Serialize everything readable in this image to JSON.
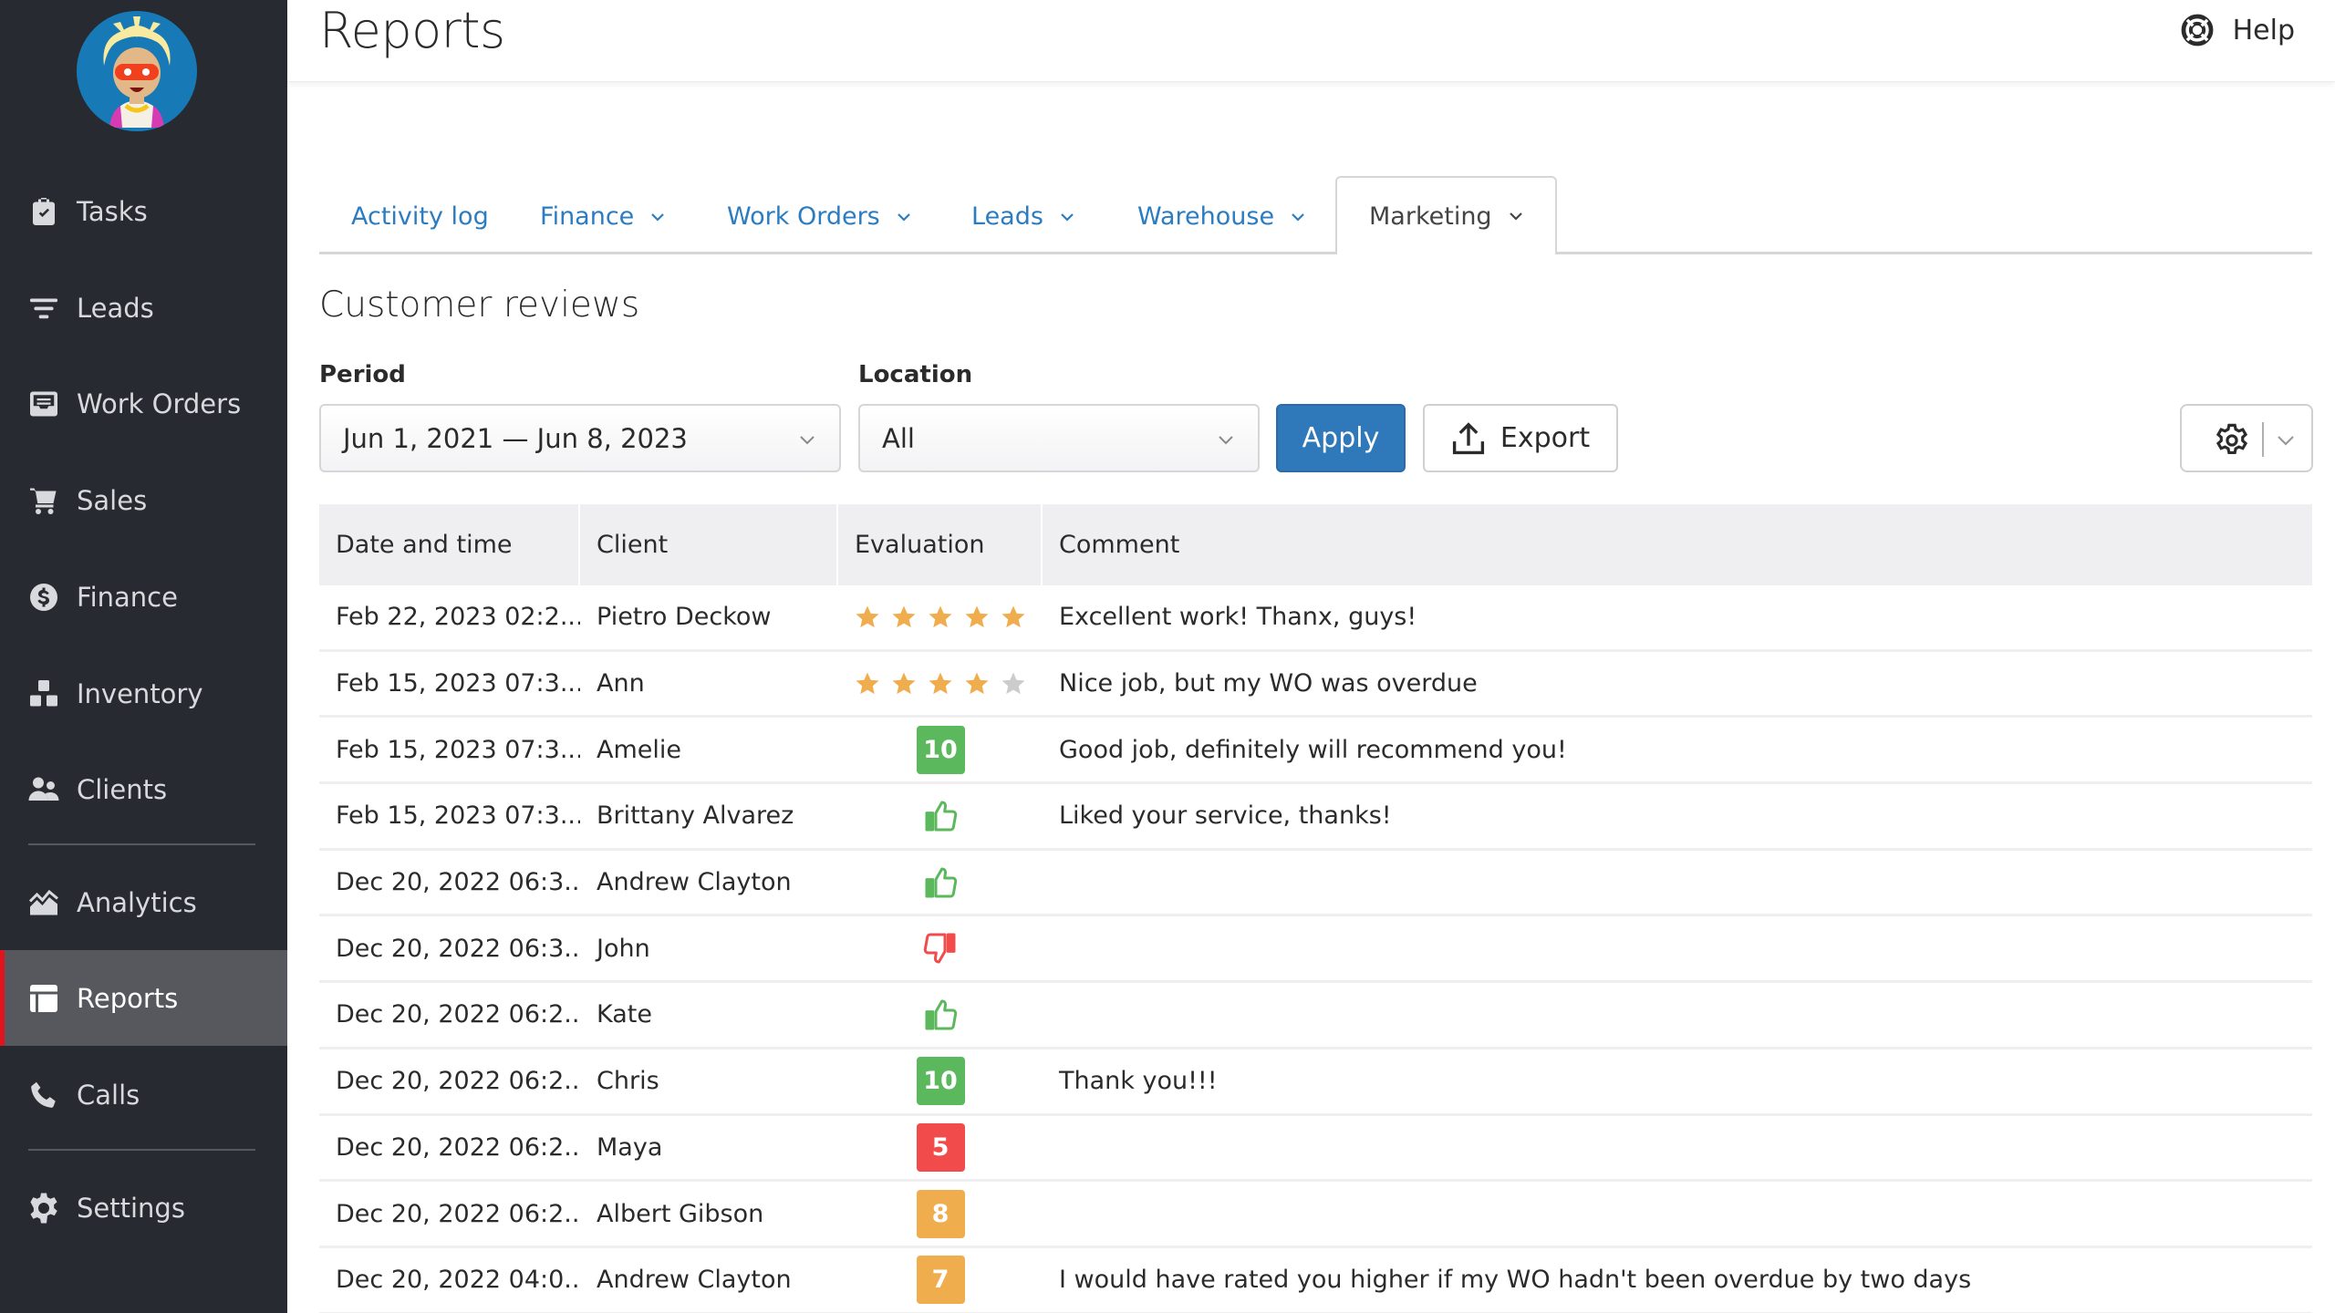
{
  "sidebar": {
    "avatar_alt": "User avatar",
    "items": [
      {
        "label": "Tasks",
        "icon": "clipboard-check-icon"
      },
      {
        "label": "Leads",
        "icon": "funnel-icon"
      },
      {
        "label": "Work Orders",
        "icon": "inbox-icon"
      },
      {
        "label": "Sales",
        "icon": "cart-icon"
      },
      {
        "label": "Finance",
        "icon": "dollar-circle-icon"
      },
      {
        "label": "Inventory",
        "icon": "boxes-icon"
      },
      {
        "label": "Clients",
        "icon": "users-icon"
      },
      {
        "label": "Analytics",
        "icon": "area-chart-icon"
      },
      {
        "label": "Reports",
        "icon": "table-icon",
        "active": true
      },
      {
        "label": "Calls",
        "icon": "phone-icon"
      },
      {
        "label": "Settings",
        "icon": "gear-icon"
      }
    ]
  },
  "header": {
    "title": "Reports",
    "help_label": "Help"
  },
  "tabs": [
    {
      "label": "Activity log",
      "dropdown": false
    },
    {
      "label": "Finance",
      "dropdown": true
    },
    {
      "label": "Work Orders",
      "dropdown": true
    },
    {
      "label": "Leads",
      "dropdown": true
    },
    {
      "label": "Warehouse",
      "dropdown": true
    },
    {
      "label": "Marketing",
      "dropdown": true,
      "active": true
    }
  ],
  "section": {
    "title": "Customer reviews",
    "period_label": "Period",
    "period_value": "Jun 1, 2021 — Jun 8, 2023",
    "location_label": "Location",
    "location_value": "All",
    "apply_label": "Apply",
    "export_label": "Export"
  },
  "colors": {
    "accent": "#2f78b9",
    "link": "#2b7cc1",
    "sidebar_bg": "#272a30",
    "active_marker": "#e0141e",
    "star": "#f0ad4e",
    "star_empty": "#cccccc",
    "score_high": "#5cb85c",
    "score_mid": "#f0ad4e",
    "score_low": "#f24b4b",
    "thumb_up": "#5cb85c",
    "thumb_down": "#f24b4b"
  },
  "table": {
    "columns": [
      "Date and time",
      "Client",
      "Evaluation",
      "Comment"
    ],
    "rows": [
      {
        "date": "Feb 22, 2023 02:2...",
        "client": "Pietro Deckow",
        "eval_type": "stars",
        "eval_value": 5,
        "eval_max": 5,
        "comment": "Excellent work! Thanx, guys!"
      },
      {
        "date": "Feb 15, 2023 07:3...",
        "client": "Ann",
        "eval_type": "stars",
        "eval_value": 4,
        "eval_max": 5,
        "comment": "Nice job, but my WO was overdue"
      },
      {
        "date": "Feb 15, 2023 07:3...",
        "client": "Amelie",
        "eval_type": "score",
        "eval_value": "10",
        "eval_level": "high",
        "comment": "Good job, definitely will recommend you!"
      },
      {
        "date": "Feb 15, 2023 07:3...",
        "client": "Brittany Alvarez",
        "eval_type": "thumb",
        "eval_value": "up",
        "comment": "Liked your service, thanks!"
      },
      {
        "date": "Dec 20, 2022 06:3...",
        "client": "Andrew Clayton",
        "eval_type": "thumb",
        "eval_value": "up",
        "comment": ""
      },
      {
        "date": "Dec 20, 2022 06:3...",
        "client": "John",
        "eval_type": "thumb",
        "eval_value": "down",
        "comment": ""
      },
      {
        "date": "Dec 20, 2022 06:2...",
        "client": "Kate",
        "eval_type": "thumb",
        "eval_value": "up",
        "comment": ""
      },
      {
        "date": "Dec 20, 2022 06:2...",
        "client": "Chris",
        "eval_type": "score",
        "eval_value": "10",
        "eval_level": "high",
        "comment": "Thank you!!!"
      },
      {
        "date": "Dec 20, 2022 06:2...",
        "client": "Maya",
        "eval_type": "score",
        "eval_value": "5",
        "eval_level": "low",
        "comment": ""
      },
      {
        "date": "Dec 20, 2022 06:2...",
        "client": "Albert Gibson",
        "eval_type": "score",
        "eval_value": "8",
        "eval_level": "mid",
        "comment": ""
      },
      {
        "date": "Dec 20, 2022 04:0...",
        "client": "Andrew Clayton",
        "eval_type": "score",
        "eval_value": "7",
        "eval_level": "mid",
        "comment": "I would have rated you higher if my WO hadn't been overdue by two days"
      }
    ]
  }
}
